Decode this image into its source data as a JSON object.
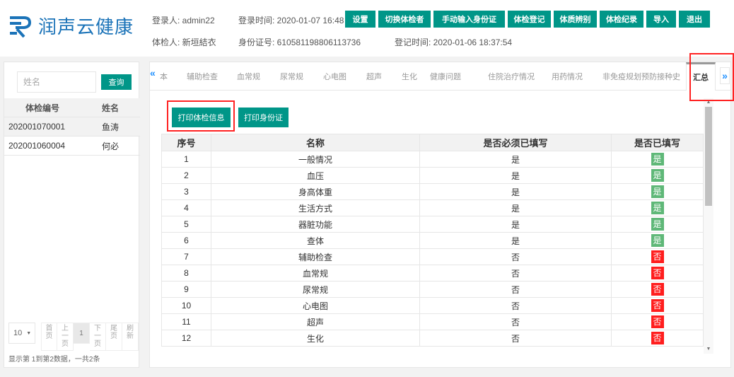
{
  "brand": {
    "name": "润声云健康"
  },
  "header": {
    "login_user": "登录人: admin22",
    "login_time": "登录时间: 2020-01-07 16:48",
    "examinee": "体检人: 新垣結衣",
    "id_card": "身份证号: 610581198806113736",
    "register_time": "登记时间: 2020-01-06 18:37:54",
    "nav": [
      "设置",
      "切换体检者",
      "手动输入身份证",
      "体检登记",
      "体质辨别",
      "体检纪录",
      "导入",
      "退出"
    ]
  },
  "sidebar": {
    "search_placeholder": "姓名",
    "query_label": "查询",
    "columns": [
      "体检编号",
      "姓名"
    ],
    "rows": [
      {
        "id": "202001070001",
        "name": "鱼涛"
      },
      {
        "id": "202001060004",
        "name": "何必"
      }
    ],
    "pager": {
      "size": "10",
      "first": [
        "首",
        "页"
      ],
      "prev": [
        "上",
        "一",
        "页"
      ],
      "current": "1",
      "next": [
        "下",
        "一",
        "页"
      ],
      "last": [
        "尾",
        "页"
      ],
      "refresh": [
        "刷",
        "新"
      ],
      "status": "显示第 1到第2数据，一共2条"
    }
  },
  "tabs": {
    "prev_symbol": "«",
    "next_symbol": "»",
    "partial_first": "本",
    "items": [
      "辅助检查",
      "血常规",
      "尿常规",
      "心电图",
      "超声",
      "生化",
      "健康问题",
      "住院治疗情况",
      "用药情况",
      "非免疫规划预防接种史"
    ],
    "active": "汇总"
  },
  "actions": {
    "print_exam": "打印体检信息",
    "print_id": "打印身份证"
  },
  "summary_table": {
    "headers": [
      "序号",
      "名称",
      "是否必须已填写",
      "是否已填写"
    ],
    "rows": [
      {
        "no": "1",
        "name": "一般情况",
        "required": "是",
        "filled": "是",
        "filled_ok": true
      },
      {
        "no": "2",
        "name": "血压",
        "required": "是",
        "filled": "是",
        "filled_ok": true
      },
      {
        "no": "3",
        "name": "身高体重",
        "required": "是",
        "filled": "是",
        "filled_ok": true
      },
      {
        "no": "4",
        "name": "生活方式",
        "required": "是",
        "filled": "是",
        "filled_ok": true
      },
      {
        "no": "5",
        "name": "器脏功能",
        "required": "是",
        "filled": "是",
        "filled_ok": true
      },
      {
        "no": "6",
        "name": "查体",
        "required": "是",
        "filled": "是",
        "filled_ok": true
      },
      {
        "no": "7",
        "name": "辅助检查",
        "required": "否",
        "filled": "否",
        "filled_ok": false
      },
      {
        "no": "8",
        "name": "血常规",
        "required": "否",
        "filled": "否",
        "filled_ok": false
      },
      {
        "no": "9",
        "name": "尿常规",
        "required": "否",
        "filled": "否",
        "filled_ok": false
      },
      {
        "no": "10",
        "name": "心电图",
        "required": "否",
        "filled": "否",
        "filled_ok": false
      },
      {
        "no": "11",
        "name": "超声",
        "required": "否",
        "filled": "否",
        "filled_ok": false
      },
      {
        "no": "12",
        "name": "生化",
        "required": "否",
        "filled": "否",
        "filled_ok": false
      }
    ]
  },
  "colors": {
    "primary": "#009688",
    "yes": "#5fb878",
    "no": "#ff1e1e",
    "brand": "#1b73b8",
    "highlight": "#ff2222"
  },
  "icons": {
    "logo": "brand-logo-icon",
    "scroll_up": "scroll-up-icon",
    "scroll_down": "scroll-down-icon",
    "size_dropdown": "chevron-down-icon"
  }
}
